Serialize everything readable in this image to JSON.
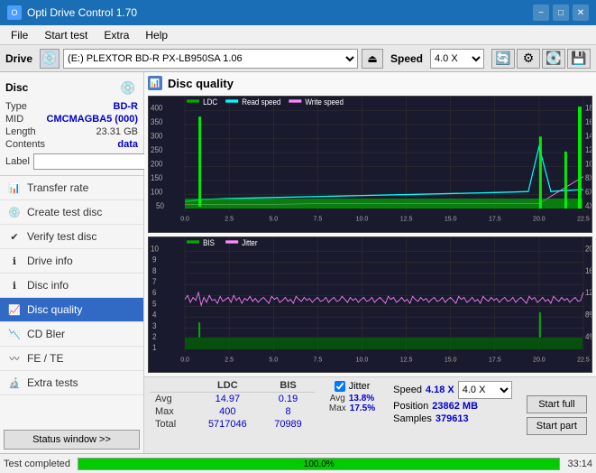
{
  "titleBar": {
    "title": "Opti Drive Control 1.70",
    "minBtn": "−",
    "maxBtn": "□",
    "closeBtn": "✕"
  },
  "menuBar": {
    "items": [
      "File",
      "Start test",
      "Extra",
      "Help"
    ]
  },
  "driveBar": {
    "label": "Drive",
    "driveValue": "(E:)  PLEXTOR BD-R   PX-LB950SA 1.06",
    "speedLabel": "Speed",
    "speedValue": "4.0 X"
  },
  "disc": {
    "title": "Disc",
    "typeLabel": "Type",
    "typeValue": "BD-R",
    "midLabel": "MID",
    "midValue": "CMCMAGBA5 (000)",
    "lengthLabel": "Length",
    "lengthValue": "23.31 GB",
    "contentsLabel": "Contents",
    "contentsValue": "data",
    "labelLabel": "Label"
  },
  "navItems": [
    {
      "id": "transfer-rate",
      "label": "Transfer rate",
      "active": false
    },
    {
      "id": "create-test-disc",
      "label": "Create test disc",
      "active": false
    },
    {
      "id": "verify-test-disc",
      "label": "Verify test disc",
      "active": false
    },
    {
      "id": "drive-info",
      "label": "Drive info",
      "active": false
    },
    {
      "id": "disc-info",
      "label": "Disc info",
      "active": false
    },
    {
      "id": "disc-quality",
      "label": "Disc quality",
      "active": true
    },
    {
      "id": "cd-bler",
      "label": "CD Bler",
      "active": false
    },
    {
      "id": "fe-te",
      "label": "FE / TE",
      "active": false
    },
    {
      "id": "extra-tests",
      "label": "Extra tests",
      "active": false
    }
  ],
  "statusBtn": "Status window >>",
  "discQuality": {
    "title": "Disc quality",
    "legend": [
      {
        "id": "ldc",
        "label": "LDC",
        "color": "#00aa00"
      },
      {
        "id": "read-speed",
        "label": "Read speed",
        "color": "#00ffff"
      },
      {
        "id": "write-speed",
        "label": "Write speed",
        "color": "#ff00ff"
      }
    ],
    "legend2": [
      {
        "id": "bis",
        "label": "BIS",
        "color": "#00aa00"
      },
      {
        "id": "jitter",
        "label": "Jitter",
        "color": "#ff88ff"
      }
    ]
  },
  "stats": {
    "headers": [
      "LDC",
      "BIS"
    ],
    "rows": [
      {
        "label": "Avg",
        "ldc": "14.97",
        "bis": "0.19"
      },
      {
        "label": "Max",
        "ldc": "400",
        "bis": "8"
      },
      {
        "label": "Total",
        "ldc": "5717046",
        "bis": "70989"
      }
    ],
    "jitter": {
      "label": "Jitter",
      "avg": "13.8%",
      "max": "17.5%"
    },
    "speed": {
      "label": "Speed",
      "value": "4.18 X",
      "posLabel": "Position",
      "posValue": "23862 MB",
      "samplesLabel": "Samples",
      "samplesValue": "379613"
    },
    "actions": {
      "startFull": "Start full",
      "startPart": "Start part"
    },
    "speedSelect": "4.0 X"
  },
  "statusBar": {
    "text": "Test completed",
    "progress": 100.0,
    "progressText": "100.0%",
    "time": "33:14"
  }
}
